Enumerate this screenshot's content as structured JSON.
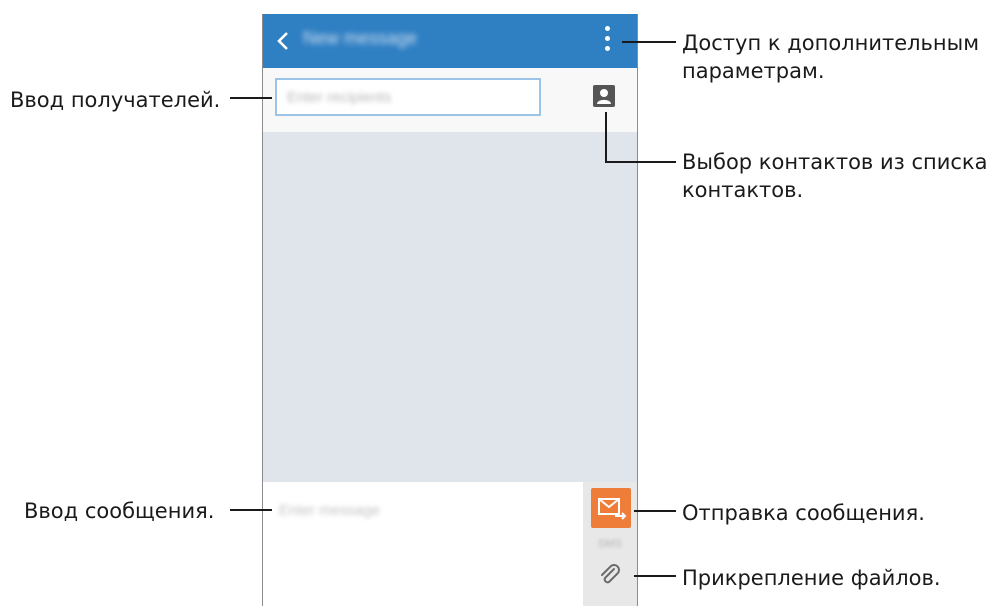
{
  "app_bar": {
    "title": "New message",
    "back_icon": "chevron-left-icon",
    "menu_icon": "more-vert-icon"
  },
  "recipients": {
    "placeholder": "Enter recipients",
    "contact_icon": "contact-icon"
  },
  "compose": {
    "placeholder": "Enter message",
    "send_icon": "send-icon",
    "send_label": "SMS",
    "attach_icon": "paperclip-icon"
  },
  "callouts": {
    "more_options": [
      "Доступ к дополнительным",
      "параметрам."
    ],
    "recipients_input": "Ввод получателей.",
    "contacts_pick": [
      "Выбор контактов из списка",
      "контактов."
    ],
    "message_input": "Ввод сообщения.",
    "send_message": "Отправка сообщения.",
    "attach_files": "Прикрепление файлов."
  },
  "colors": {
    "app_bar": "#2f7fc3",
    "send_button": "#ef7d3a",
    "content_bg": "#dfe5eb"
  }
}
